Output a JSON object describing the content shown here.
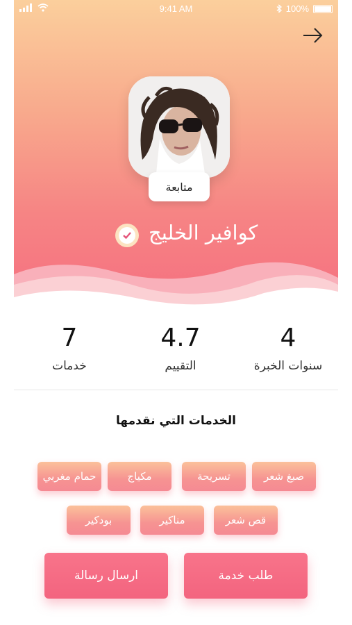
{
  "status": {
    "time": "9:41 AM",
    "battery": "100%"
  },
  "profile": {
    "follow_label": "متابعة",
    "name": "كوافير الخليج"
  },
  "stats": [
    {
      "value": "4",
      "label": "سنوات الخبرة"
    },
    {
      "value": "4.7",
      "label": "التقييم"
    },
    {
      "value": "7",
      "label": "خدمات"
    }
  ],
  "services": {
    "title": "الخدمات التي نقدمها",
    "items": [
      "صبغ شعر",
      "تسريحة",
      "مكياج",
      "حمام مغربي",
      "قص شعر",
      "مناكير",
      "بودكير"
    ]
  },
  "actions": {
    "request_service": "طلب خدمة",
    "send_message": "ارسال رسالة"
  },
  "colors": {
    "accent": "#f3647f",
    "hero_top": "#fbcf9c",
    "hero_bottom": "#f57080"
  }
}
